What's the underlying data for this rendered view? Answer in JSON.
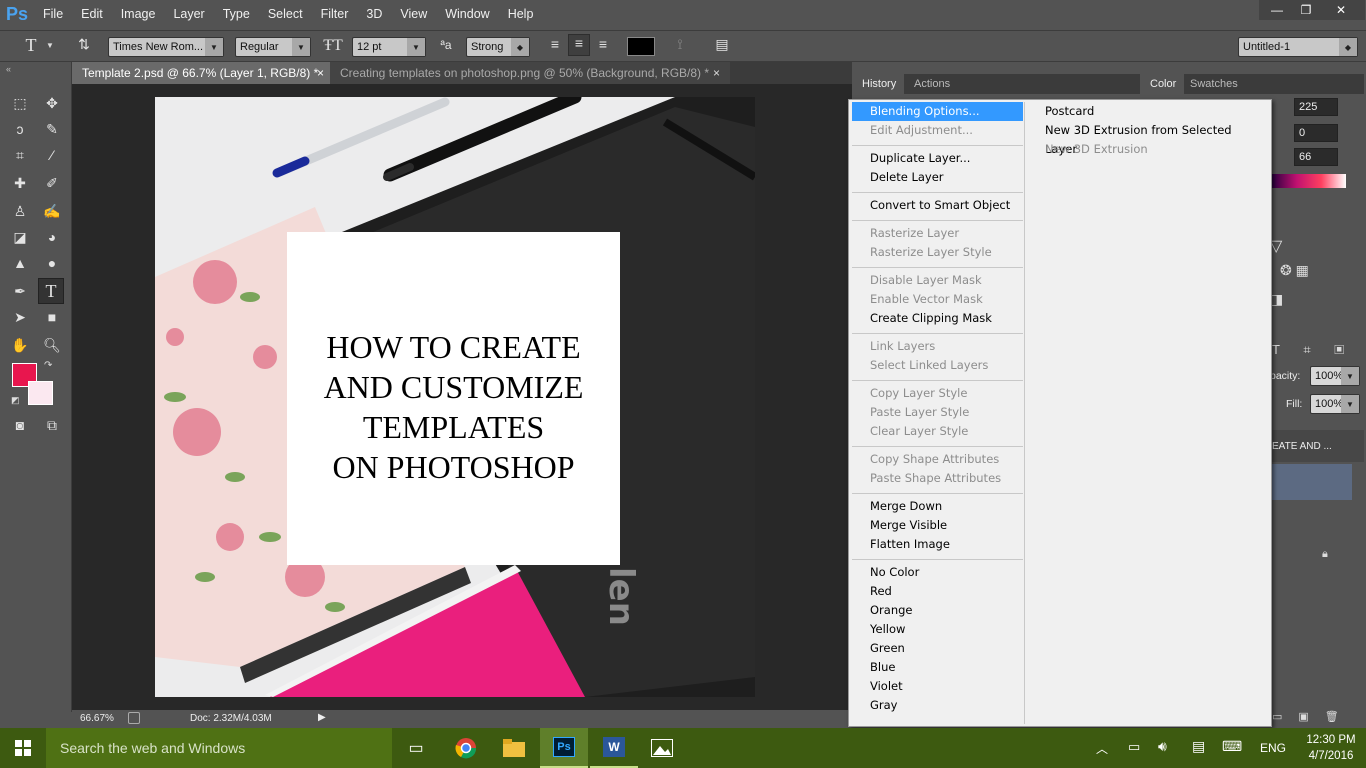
{
  "app": {
    "logo": "Ps"
  },
  "menu": [
    "File",
    "Edit",
    "Image",
    "Layer",
    "Type",
    "Select",
    "Filter",
    "3D",
    "View",
    "Window",
    "Help"
  ],
  "window_controls": {
    "minimize": "—",
    "restore": "❐",
    "close": "✕"
  },
  "options": {
    "tool_glyph": "T",
    "font_family": "Times New Rom...",
    "font_style": "Regular",
    "font_size": "12 pt",
    "aa_glyph": "ªa",
    "antialias": "Strong",
    "workspace": "Untitled-1"
  },
  "tabs": [
    {
      "label": "Template 2.psd @ 66.7% (Layer 1, RGB/8) *"
    },
    {
      "label": "Creating templates on photoshop.png @ 50% (Background, RGB/8) *"
    }
  ],
  "tab_close": "×",
  "canvas": {
    "lines": [
      "HOW TO CREATE",
      "AND CUSTOMIZE",
      "TEMPLATES",
      "ON PHOTOSHOP"
    ],
    "brand": "len"
  },
  "colors": {
    "foreground": "#e8164e",
    "background": "#fbe8f0",
    "highlight": "#3399ff",
    "taskbar": "#3d5a10"
  },
  "status": {
    "zoom": "66.67%",
    "doc": "Doc: 2.32M/4.03M"
  },
  "panels": {
    "history_tab": "History",
    "actions_tab": "Actions",
    "color_tab": "Color",
    "swatches_tab": "Swatches",
    "color_values": [
      "225",
      "0",
      "66"
    ],
    "opacity_label": "pacity:",
    "opacity_value": "100%",
    "fill_label": "Fill:",
    "fill_value": "100%",
    "layer_name": "EATE AND ..."
  },
  "context_menu": {
    "left": [
      {
        "label": "Blending Options...",
        "state": "highlight"
      },
      {
        "label": "Edit Adjustment...",
        "state": "disabled"
      },
      {
        "label": "Duplicate Layer...",
        "state": "enabled"
      },
      {
        "label": "Delete Layer",
        "state": "enabled"
      },
      {
        "label": "Convert to Smart Object",
        "state": "enabled"
      },
      {
        "label": "Rasterize Layer",
        "state": "disabled"
      },
      {
        "label": "Rasterize Layer Style",
        "state": "disabled"
      },
      {
        "label": "Disable Layer Mask",
        "state": "disabled"
      },
      {
        "label": "Enable Vector Mask",
        "state": "disabled"
      },
      {
        "label": "Create Clipping Mask",
        "state": "enabled"
      },
      {
        "label": "Link Layers",
        "state": "disabled"
      },
      {
        "label": "Select Linked Layers",
        "state": "disabled"
      },
      {
        "label": "Copy Layer Style",
        "state": "disabled"
      },
      {
        "label": "Paste Layer Style",
        "state": "disabled"
      },
      {
        "label": "Clear Layer Style",
        "state": "disabled"
      },
      {
        "label": "Copy Shape Attributes",
        "state": "disabled"
      },
      {
        "label": "Paste Shape Attributes",
        "state": "disabled"
      },
      {
        "label": "Merge Down",
        "state": "enabled"
      },
      {
        "label": "Merge Visible",
        "state": "enabled"
      },
      {
        "label": "Flatten Image",
        "state": "enabled"
      },
      {
        "label": "No Color",
        "state": "enabled"
      },
      {
        "label": "Red",
        "state": "enabled"
      },
      {
        "label": "Orange",
        "state": "enabled"
      },
      {
        "label": "Yellow",
        "state": "enabled"
      },
      {
        "label": "Green",
        "state": "enabled"
      },
      {
        "label": "Blue",
        "state": "enabled"
      },
      {
        "label": "Violet",
        "state": "enabled"
      },
      {
        "label": "Gray",
        "state": "enabled"
      }
    ],
    "right": [
      {
        "label": "Postcard",
        "state": "enabled"
      },
      {
        "label": "New 3D Extrusion from Selected Layer",
        "state": "enabled"
      },
      {
        "label": "New 3D Extrusion",
        "state": "disabled"
      }
    ]
  },
  "taskbar": {
    "search_placeholder": "Search the web and Windows",
    "language": "ENG",
    "time": "12:30 PM",
    "date": "4/7/2016",
    "ps_label": "Ps",
    "word_label": "W"
  }
}
